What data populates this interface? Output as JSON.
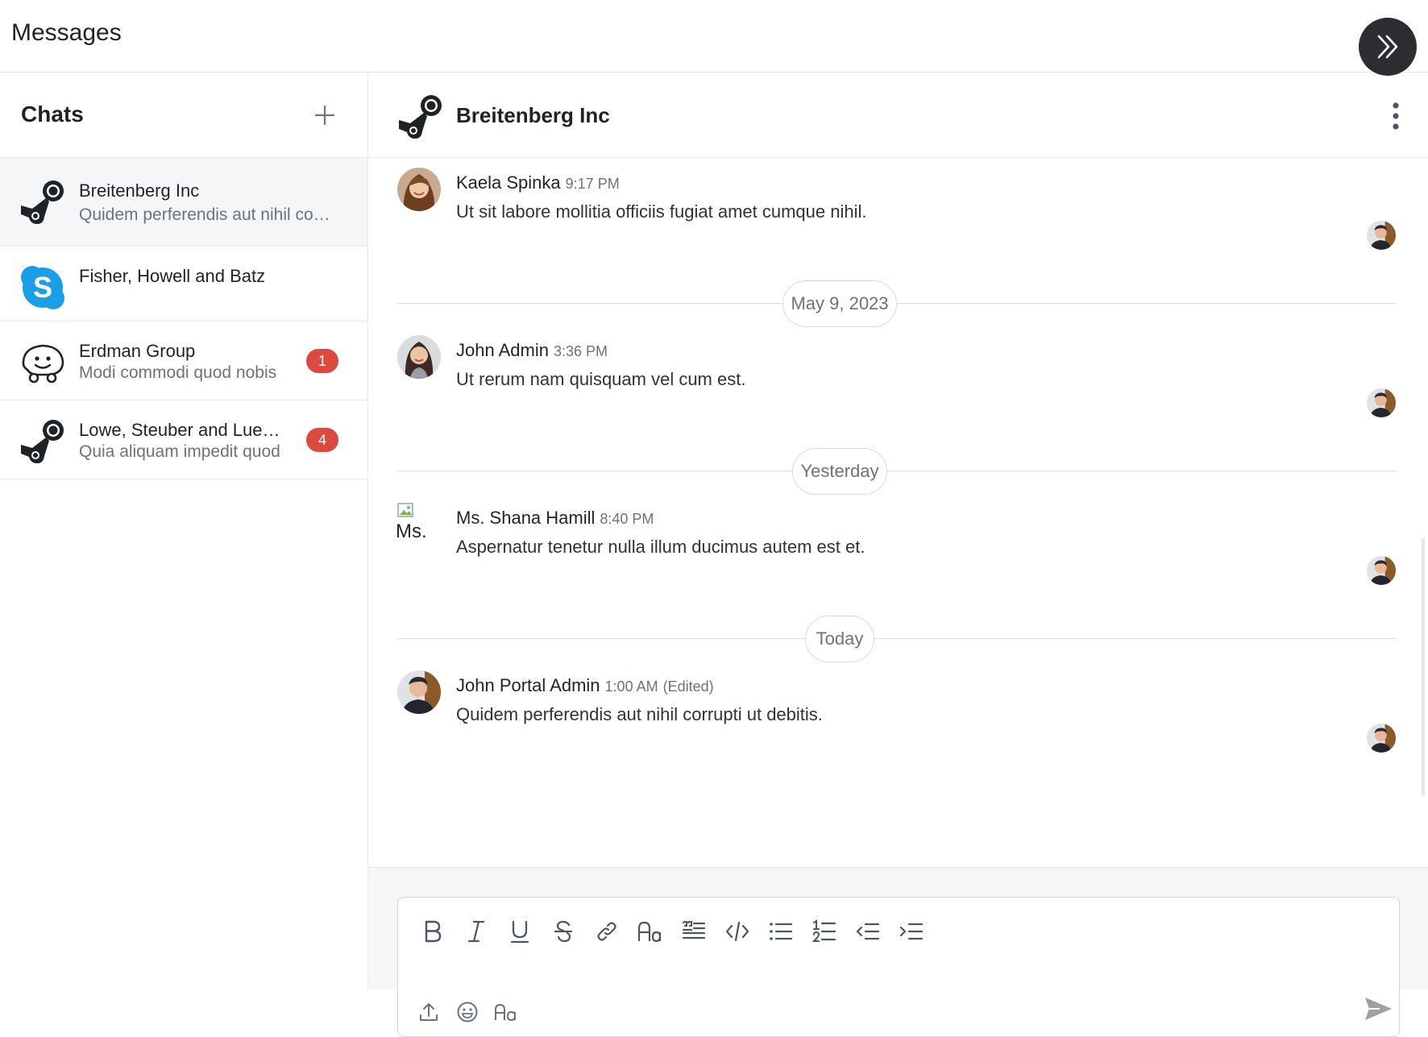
{
  "app": {
    "title": "Messages"
  },
  "sidebar": {
    "title": "Chats",
    "chats": [
      {
        "name": "Breitenberg Inc",
        "preview": "Quidem perferendis aut nihil corrupti ut debitis.",
        "icon": "steam-logo-icon",
        "unread": ""
      },
      {
        "name": "Fisher, Howell and Batz",
        "preview": "",
        "icon": "skype-logo-icon",
        "unread": ""
      },
      {
        "name": "Erdman Group",
        "preview": "Modi commodi quod nobis",
        "icon": "waze-logo-icon",
        "unread": "1"
      },
      {
        "name": "Lowe, Steuber and Lueilwitz",
        "preview": "Quia aliquam impedit quod",
        "icon": "steam-logo-icon",
        "unread": "4"
      }
    ]
  },
  "conversation": {
    "title": "Breitenberg Inc",
    "messages": [
      {
        "sender": "Kaela Spinka",
        "time": "9:17 PM",
        "text": "Ut sit labore mollitia officiis fugiat amet cumque nihil.",
        "edited": ""
      },
      {
        "sender": "John Admin",
        "time": "3:36 PM",
        "text": "Ut rerum nam quisquam vel cum est.",
        "edited": ""
      },
      {
        "sender": "Ms. Shana Hamill",
        "time": "8:40 PM",
        "text": "Aspernatur tenetur nulla illum ducimus autem est et.",
        "edited": "",
        "avatar_alt": "Ms."
      },
      {
        "sender": "John Portal Admin",
        "time": "1:00 AM",
        "text": "Quidem perferendis aut nihil corrupti ut debitis.",
        "edited": "(Edited)"
      }
    ],
    "dividers": [
      "May 9, 2023",
      "Yesterday",
      "Today"
    ]
  },
  "composer": {
    "toolbar": [
      "bold-icon",
      "italic-icon",
      "underline-icon",
      "strikethrough-icon",
      "link-icon",
      "text-size-icon",
      "quote-icon",
      "code-icon",
      "bullet-list-icon",
      "numbered-list-icon",
      "outdent-icon",
      "indent-icon"
    ],
    "bottom": [
      "upload-icon",
      "emoji-icon",
      "formatting-icon"
    ]
  },
  "colors": {
    "badge": "#dc4a3f",
    "skype": "#1a9fe6",
    "dark_button": "#2b2d31"
  }
}
